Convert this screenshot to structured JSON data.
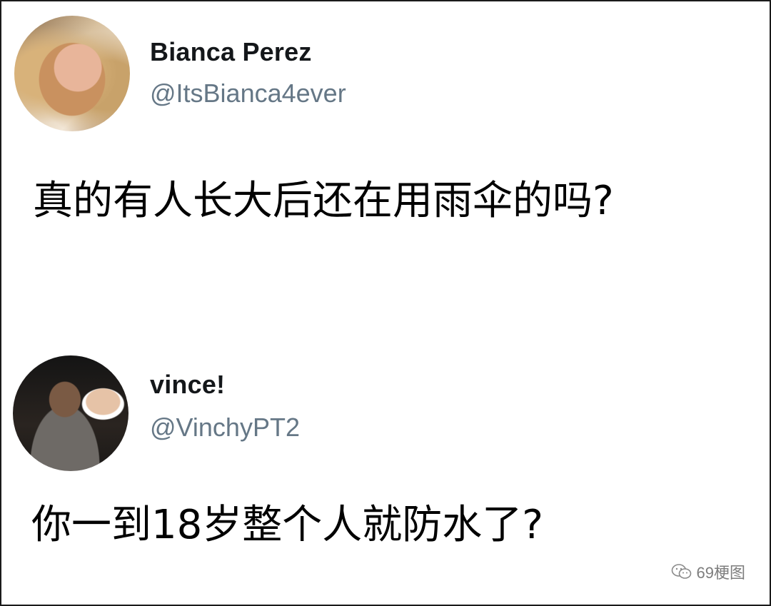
{
  "tweets": [
    {
      "name": "Bianca Perez",
      "handle": "@ItsBianca4ever",
      "text": "真的有人长大后还在用雨伞的吗?"
    },
    {
      "name": "vince!",
      "handle": "@VinchyPT2",
      "text": "你一到18岁整个人就防水了?"
    }
  ],
  "watermark": {
    "icon": "wechat-icon",
    "label": "69梗图"
  }
}
